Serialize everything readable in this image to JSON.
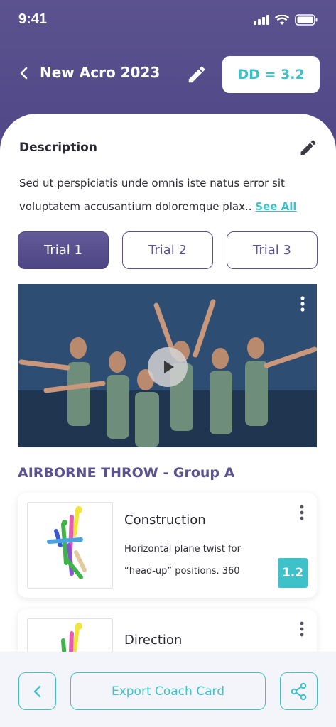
{
  "status": {
    "time": "9:41"
  },
  "nav": {
    "title": "New Acro 2023",
    "dd_label": "DD = 3.2"
  },
  "description": {
    "heading": "Description",
    "text": "Sed ut perspiciatis unde omnis iste natus error sit voluptatem accusantium doloremque plax.. ",
    "see_all": "See All"
  },
  "trials": [
    {
      "label": "Trial 1",
      "active": true
    },
    {
      "label": "Trial 2",
      "active": false
    },
    {
      "label": "Trial 3",
      "active": false
    }
  ],
  "section": {
    "title": "AIRBORNE THROW - Group A"
  },
  "cards": [
    {
      "title": "Construction",
      "line1": "Horizontal plane twist for",
      "line2": "“head-up” positions. 360",
      "score": "1.2"
    },
    {
      "title": "Direction"
    }
  ],
  "bottom": {
    "export_label": "Export Coach Card"
  },
  "colors": {
    "primary": "#5b528f",
    "accent": "#3fc1c9"
  }
}
